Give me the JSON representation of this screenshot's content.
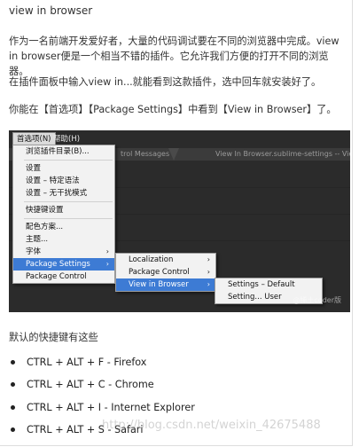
{
  "article": {
    "title": "view in browser",
    "p1": "作为一名前端开发爱好者，大量的代码调试要在不同的浏览器中完成。view in browser便是一个相当不错的插件。它允许我们方便的打开不同的浏览器。",
    "p2": "在插件面板中输入view in...就能看到这款插件，选中回车就安装好了。",
    "p3": "你能在【首选项】【Package Settings】中看到【View in Browser】了。",
    "shortcut_heading": "默认的快捷键有这些",
    "shortcuts": [
      "CTRL + ALT + F - Firefox",
      "CTRL + ALT + C - Chrome",
      "CTRL + ALT + I - Internet Explorer",
      "CTRL + ALT + S - Safari"
    ],
    "page_watermark": "http://blog.csdn.net/weixin_42675488"
  },
  "screenshot": {
    "menubar": [
      "首选项(N)",
      "帮助(H)"
    ],
    "tabs": [
      "trol Messages",
      "View In Browser.sublime-settings -- View In"
    ],
    "menu1": [
      "浏览插件目录(B)...",
      "设置",
      "设置 – 特定语法",
      "设置 – 无干扰模式",
      "快捷键设置",
      "配色方案...",
      "主题...",
      "字体",
      "Package Settings",
      "Package Control"
    ],
    "menu2": [
      "Localization",
      "Package Control",
      "View in Browser"
    ],
    "menu3": [
      "Settings – Default",
      "Setting... User"
    ],
    "watermark": "@稀土coder版"
  }
}
